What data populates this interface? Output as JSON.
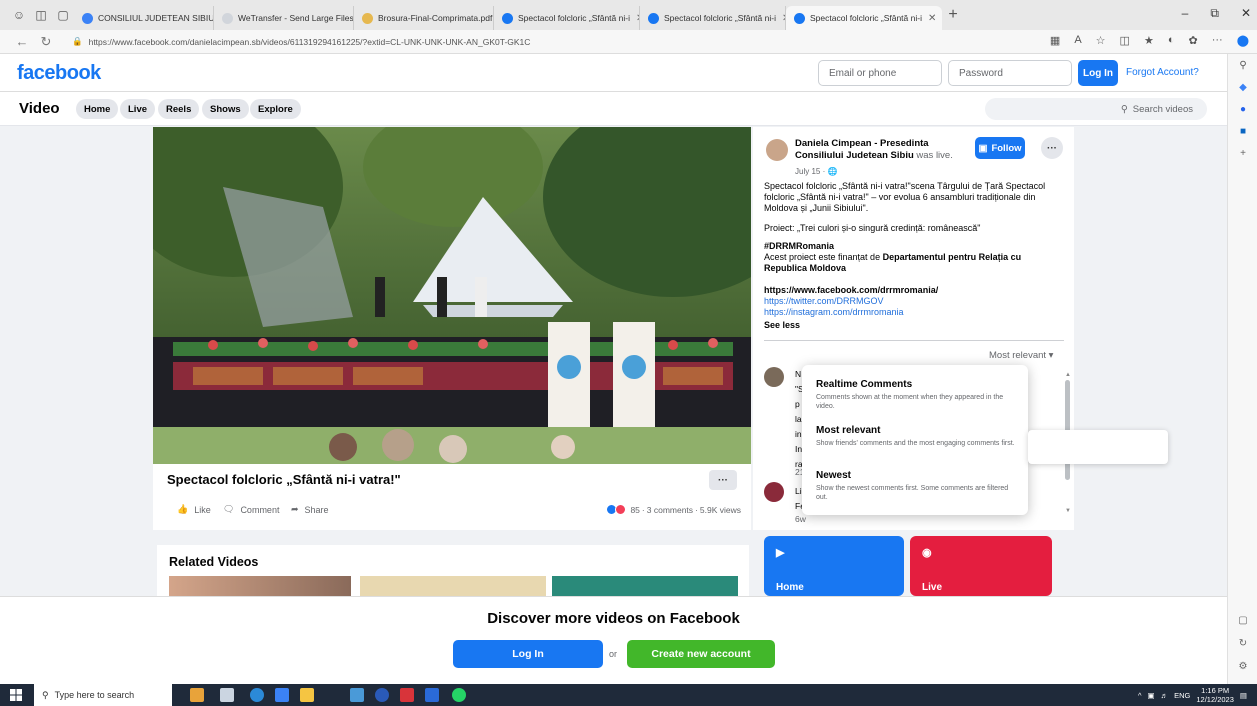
{
  "browser": {
    "tabs": [
      {
        "label": "CONSILIUL JUDETEAN SIBIU - D",
        "color": "#3b82f6"
      },
      {
        "label": "WeTransfer - Send Large Files &",
        "color": "#d1d5db"
      },
      {
        "label": "Brosura-Final-Comprimata.pdf -",
        "color": "#e6b84f"
      },
      {
        "label": "Spectacol folcloric „Sfântă ni-i",
        "color": "#1877f2"
      },
      {
        "label": "Spectacol folcloric „Sfântă ni-i",
        "color": "#1877f2"
      },
      {
        "label": "Spectacol folcloric „Sfântă ni-i",
        "color": "#1877f2"
      }
    ],
    "url": "https://www.facebook.com/danielacimpean.sb/videos/611319294161225/?extid=CL-UNK-UNK-UNK-AN_GK0T-GK1C"
  },
  "header": {
    "logo": "facebook",
    "email_placeholder": "Email or phone",
    "password_placeholder": "Password",
    "login_label": "Log In",
    "forgot_label": "Forgot Account?"
  },
  "video_nav": {
    "title": "Video",
    "pills": [
      "Home",
      "Live",
      "Reels",
      "Shows",
      "Explore"
    ],
    "search_placeholder": "Search videos"
  },
  "video": {
    "title": "Spectacol folcloric „Sfântă ni-i vatra!\"",
    "more_label": "···",
    "actions": [
      "Like",
      "Comment",
      "Share"
    ],
    "reactions_count": "85",
    "comments": "3 comments",
    "views": "5.9K views"
  },
  "post": {
    "author": "Daniela Cimpean - Presedinta Consiliului Judetean Sibiu",
    "status": "was live.",
    "date": "July 15 ·",
    "follow_label": "Follow",
    "more_label": "···",
    "desc1": "Spectacol folcloric „Sfântă ni-i vatra!\"scena Târgului de Țară Spectacol folcloric „Sfântă ni-i vatra!\" – vor evolua 6 ansambluri tradiționale din Moldova și „Junii Sibiului\".",
    "desc2": "Proiect: „Trei culori și-o singură credință: românească\"",
    "hashtag": "#DRRMRomania",
    "desc3_a": "Acest proiect este finanțat de ",
    "desc3_b": "Departamentul pentru Relația cu Republica Moldova",
    "link1": "https://www.facebook.com/drrmromania/",
    "link2": "https://twitter.com/DRRMGOV",
    "link3": "https://instagram.com/drrmromania",
    "see_less": "See less",
    "sort_label": "Most relevant"
  },
  "comments_peek": {
    "c1_lines": [
      "N",
      "\"S",
      "p",
      "la",
      "in",
      "In",
      "ra"
    ],
    "c1_time": "21",
    "c2_lines": [
      "Li",
      "Fe"
    ],
    "c2_time": "6w"
  },
  "dropdown": {
    "items": [
      {
        "title": "Realtime Comments",
        "desc": "Comments shown at the moment when they appeared in the video."
      },
      {
        "title": "Most relevant",
        "desc": "Show friends' comments and the most engaging comments first."
      },
      {
        "title": "Newest",
        "desc": "Show the newest comments first. Some comments are filtered out."
      }
    ]
  },
  "related": {
    "title": "Related Videos",
    "cards": [
      {
        "label": "Home",
        "color": "#1877f2"
      },
      {
        "label": "Live",
        "color": "#e41e3f"
      }
    ]
  },
  "discover": {
    "title": "Discover more videos on Facebook",
    "login_label": "Log In",
    "or_label": "or",
    "create_label": "Create new account"
  },
  "taskbar": {
    "search_placeholder": "Type here to search",
    "lang": "ENG",
    "time": "1:16 PM",
    "date": "12/12/2023"
  }
}
